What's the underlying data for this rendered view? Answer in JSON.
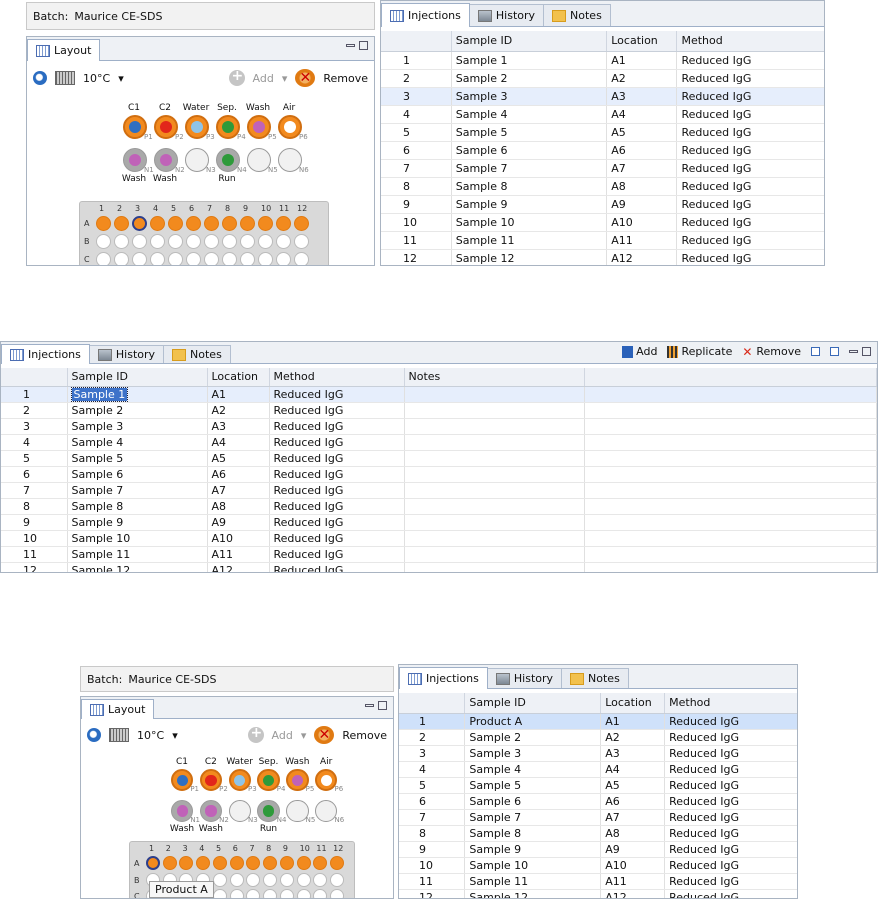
{
  "batch": {
    "label": "Batch:",
    "name": "Maurice CE-SDS"
  },
  "tabs": {
    "injections": "Injections",
    "history": "History",
    "notes": "Notes"
  },
  "layout": {
    "title": "Layout",
    "temperature": "10°C",
    "add_label": "Add",
    "remove_label": "Remove",
    "tooltip": "Product A"
  },
  "vials": {
    "top_labels": [
      "C1",
      "C2",
      "Water",
      "Sep.",
      "Wash",
      "Air"
    ],
    "top_positions": [
      "P1",
      "P2",
      "P3",
      "P4",
      "P5",
      "P6"
    ],
    "top_inner_colors": [
      "#2f6fc2",
      "#e2261b",
      "#8fc4e8",
      "#2e9a3a",
      "#c062b8",
      "#ffffff"
    ],
    "bottom_labels": [
      "Wash",
      "Wash",
      "",
      "Run",
      "",
      ""
    ],
    "bottom_positions": [
      "N1",
      "N2",
      "N3",
      "N4",
      "N5",
      "N6"
    ],
    "bottom_inner_colors": [
      "#c062b8",
      "#c062b8",
      null,
      "#2e9a3a",
      null,
      null
    ]
  },
  "plate": {
    "columns": [
      "1",
      "2",
      "3",
      "4",
      "5",
      "6",
      "7",
      "8",
      "9",
      "10",
      "11",
      "12"
    ],
    "rows": [
      "A",
      "B",
      "C"
    ]
  },
  "toolbar": {
    "add": "Add",
    "replicate": "Replicate",
    "remove": "Remove"
  },
  "table": {
    "columns": [
      "",
      "Sample ID",
      "Location",
      "Method",
      "Notes"
    ],
    "rows": [
      [
        "1",
        "Sample 1",
        "A1",
        "Reduced IgG"
      ],
      [
        "2",
        "Sample 2",
        "A2",
        "Reduced IgG"
      ],
      [
        "3",
        "Sample 3",
        "A3",
        "Reduced IgG"
      ],
      [
        "4",
        "Sample 4",
        "A4",
        "Reduced IgG"
      ],
      [
        "5",
        "Sample 5",
        "A5",
        "Reduced IgG"
      ],
      [
        "6",
        "Sample 6",
        "A6",
        "Reduced IgG"
      ],
      [
        "7",
        "Sample 7",
        "A7",
        "Reduced IgG"
      ],
      [
        "8",
        "Sample 8",
        "A8",
        "Reduced IgG"
      ],
      [
        "9",
        "Sample 9",
        "A9",
        "Reduced IgG"
      ],
      [
        "10",
        "Sample 10",
        "A10",
        "Reduced IgG"
      ],
      [
        "11",
        "Sample 11",
        "A11",
        "Reduced IgG"
      ],
      [
        "12",
        "Sample 12",
        "A12",
        "Reduced IgG"
      ]
    ],
    "renamed_first_sample": "Product A"
  },
  "colors": {
    "orange": "#f28a1e",
    "selection": "#3d72c9",
    "plate_gray": "#d9d9d9"
  }
}
